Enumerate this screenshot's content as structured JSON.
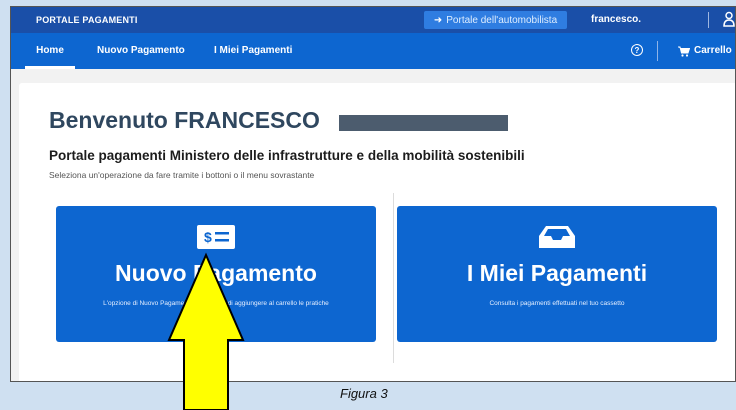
{
  "header": {
    "brand": "PORTALE PAGAMENTI",
    "portal_button": "Portale dell'automobilista",
    "username": "francesco."
  },
  "nav": {
    "home": "Home",
    "new_payment": "Nuovo Pagamento",
    "my_payments": "I Miei Pagamenti",
    "cart": "Carrello"
  },
  "main": {
    "welcome": "Benvenuto FRANCESCO",
    "subtitle": "Portale pagamenti Ministero delle infrastrutture e della mobilità sostenibili",
    "hint": "Seleziona un'operazione da fare tramite i bottoni o il menu sovrastante"
  },
  "cards": [
    {
      "title": "Nuovo Pagamento",
      "description": "L'opzione di Nuovo Pagamento ti permette di aggiungere al carrello le pratiche",
      "icon": "receipt-icon"
    },
    {
      "title": "I Miei Pagamenti",
      "description": "Consulta i pagamenti effettuati nel tuo cassetto",
      "icon": "inbox-tray-icon"
    }
  ],
  "caption": "Figura 3",
  "colors": {
    "topbar": "#1a4fa8",
    "navbar": "#0d66d0",
    "card": "#0d66d0",
    "arrow": "#ffff00"
  }
}
